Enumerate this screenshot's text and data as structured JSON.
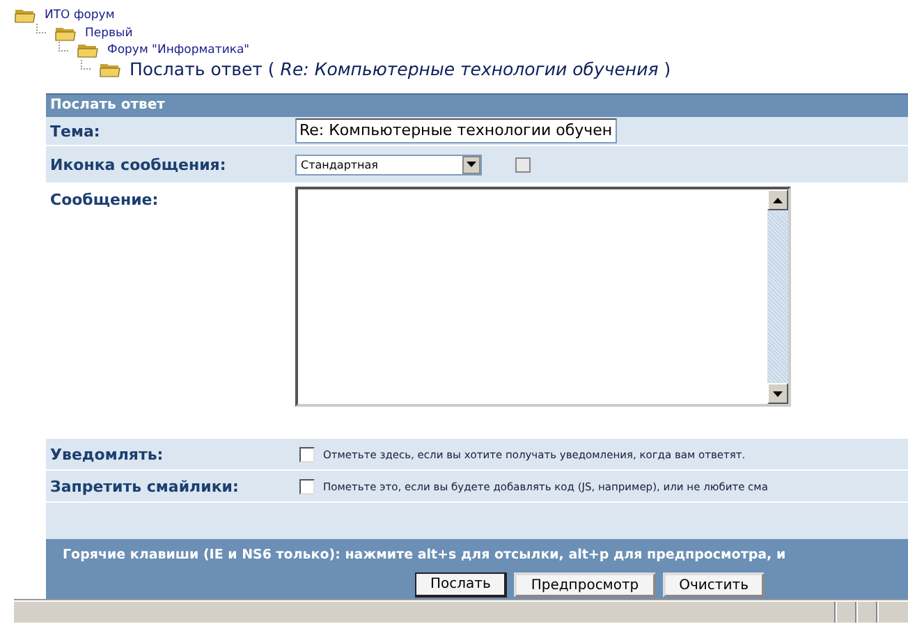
{
  "breadcrumb": [
    {
      "label": "ИТО форум",
      "children": [
        {
          "label": "Первый",
          "children": [
            {
              "label": "Форум \"Информатика\"",
              "children": [
                {
                  "label": "Послать ответ ( *Re: Компьютерные технологии обучения* )"
                }
              ]
            }
          ]
        }
      ]
    }
  ],
  "form": {
    "title": "Послать ответ",
    "subject": {
      "label": "Тема:",
      "value": "Re: Компьютерные технологии обучен"
    },
    "icon": {
      "label": "Иконка сообщения:",
      "value": "Стандартная"
    },
    "message": {
      "label": "Сообщение:"
    },
    "options": [
      {
        "label": "Уведомлять:",
        "text": "Отметьте здесь, если вы хотите получать уведомления, когда вам ответят.",
        "checked": false
      },
      {
        "label": "Запретить смайлики:",
        "text": "Пометьте это, если вы будете добавлять код (JS, например), или не любите сма",
        "checked": false
      }
    ],
    "hotkeys": "Горячие клавиши (IE и NS6 только): нажмите alt+s для отсылки, alt+p для предпросмотра, и",
    "buttons": [
      "Послать",
      "Предпросмотр",
      "Очистить"
    ]
  }
}
